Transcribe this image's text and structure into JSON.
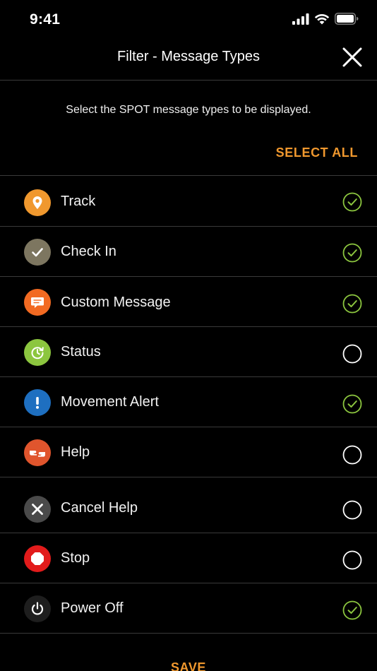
{
  "status_bar": {
    "time": "9:41"
  },
  "nav": {
    "title": "Filter - Message Types"
  },
  "intro": {
    "text": "Select the SPOT message types to be displayed.",
    "select_all_label": "SELECT ALL"
  },
  "colors": {
    "accent": "#f0982e",
    "check_green": "#8cc63f",
    "divider": "#3a3a3a"
  },
  "items": [
    {
      "label": "Track",
      "icon": "location-pin-icon",
      "icon_color": "#f0982e",
      "selected": true
    },
    {
      "label": "Check In",
      "icon": "checkmark-icon",
      "icon_color": "#7d7660",
      "selected": true
    },
    {
      "label": "Custom Message",
      "icon": "chat-bubble-icon",
      "icon_color": "#f26a22",
      "selected": true
    },
    {
      "label": "Status",
      "icon": "clock-refresh-icon",
      "icon_color": "#8cc63f",
      "selected": false
    },
    {
      "label": "Movement Alert",
      "icon": "exclamation-icon",
      "icon_color": "#1e6fc0",
      "selected": true
    },
    {
      "label": "Help",
      "icon": "hands-icon",
      "icon_color": "#e0552d",
      "selected": false
    },
    {
      "label": "Cancel Help",
      "icon": "x-icon",
      "icon_color": "#4a4a4a",
      "selected": false
    },
    {
      "label": "Stop",
      "icon": "stop-octagon-icon",
      "icon_color": "#e21b1b",
      "selected": false
    },
    {
      "label": "Power Off",
      "icon": "power-icon",
      "icon_color": "#1e1e1e",
      "selected": true
    }
  ],
  "footer": {
    "save_label": "SAVE"
  }
}
